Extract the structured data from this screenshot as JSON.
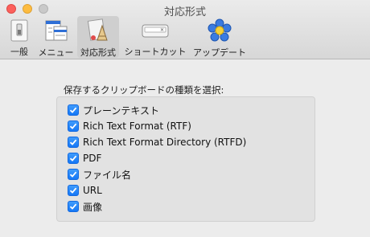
{
  "window": {
    "title": "対応形式"
  },
  "toolbar": {
    "items": [
      {
        "label": "一般",
        "icon": "switch-icon"
      },
      {
        "label": "メニュー",
        "icon": "menu-icon"
      },
      {
        "label": "対応形式",
        "icon": "formats-icon",
        "selected": true
      },
      {
        "label": "ショートカット",
        "icon": "keyboard-icon"
      },
      {
        "label": "アップデート",
        "icon": "update-icon"
      }
    ]
  },
  "formats": {
    "caption": "保存するクリップボードの種類を選択:",
    "options": [
      {
        "label": "プレーンテキスト",
        "checked": true
      },
      {
        "label": "Rich Text Format (RTF)",
        "checked": true
      },
      {
        "label": "Rich Text Format Directory (RTFD)",
        "checked": true
      },
      {
        "label": "PDF",
        "checked": true
      },
      {
        "label": "ファイル名",
        "checked": true
      },
      {
        "label": "URL",
        "checked": true
      },
      {
        "label": "画像",
        "checked": true
      }
    ]
  },
  "colors": {
    "accent": "#1577f6",
    "close": "#fc605c",
    "minimize": "#fdbc40"
  }
}
